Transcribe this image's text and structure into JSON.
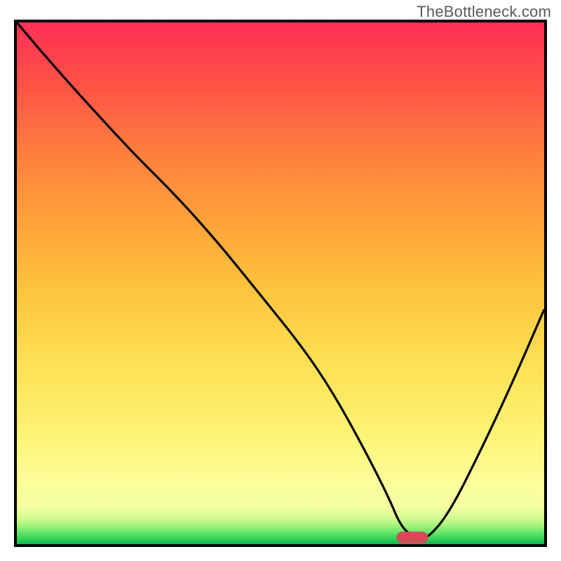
{
  "watermark": "TheBottleneck.com",
  "chart_data": {
    "type": "line",
    "title": "",
    "xlabel": "",
    "ylabel": "",
    "xlim": [
      0,
      100
    ],
    "ylim": [
      0,
      100
    ],
    "grid": false,
    "series": [
      {
        "name": "bottleneck-curve",
        "x": [
          0,
          5,
          12,
          22,
          30,
          38,
          46,
          54,
          60,
          66,
          70.5,
          73,
          76,
          78,
          82,
          88,
          94,
          100
        ],
        "y": [
          100,
          94,
          86,
          75,
          67,
          58,
          48,
          38,
          29,
          18,
          9,
          3,
          1,
          1.2,
          6,
          18,
          31,
          45
        ]
      }
    ],
    "marker": {
      "name": "optimal-range-pill",
      "x_center": 75,
      "y_center": 1.3,
      "width_x": 6,
      "height_y": 2.2,
      "color": "#d54a5a"
    }
  }
}
